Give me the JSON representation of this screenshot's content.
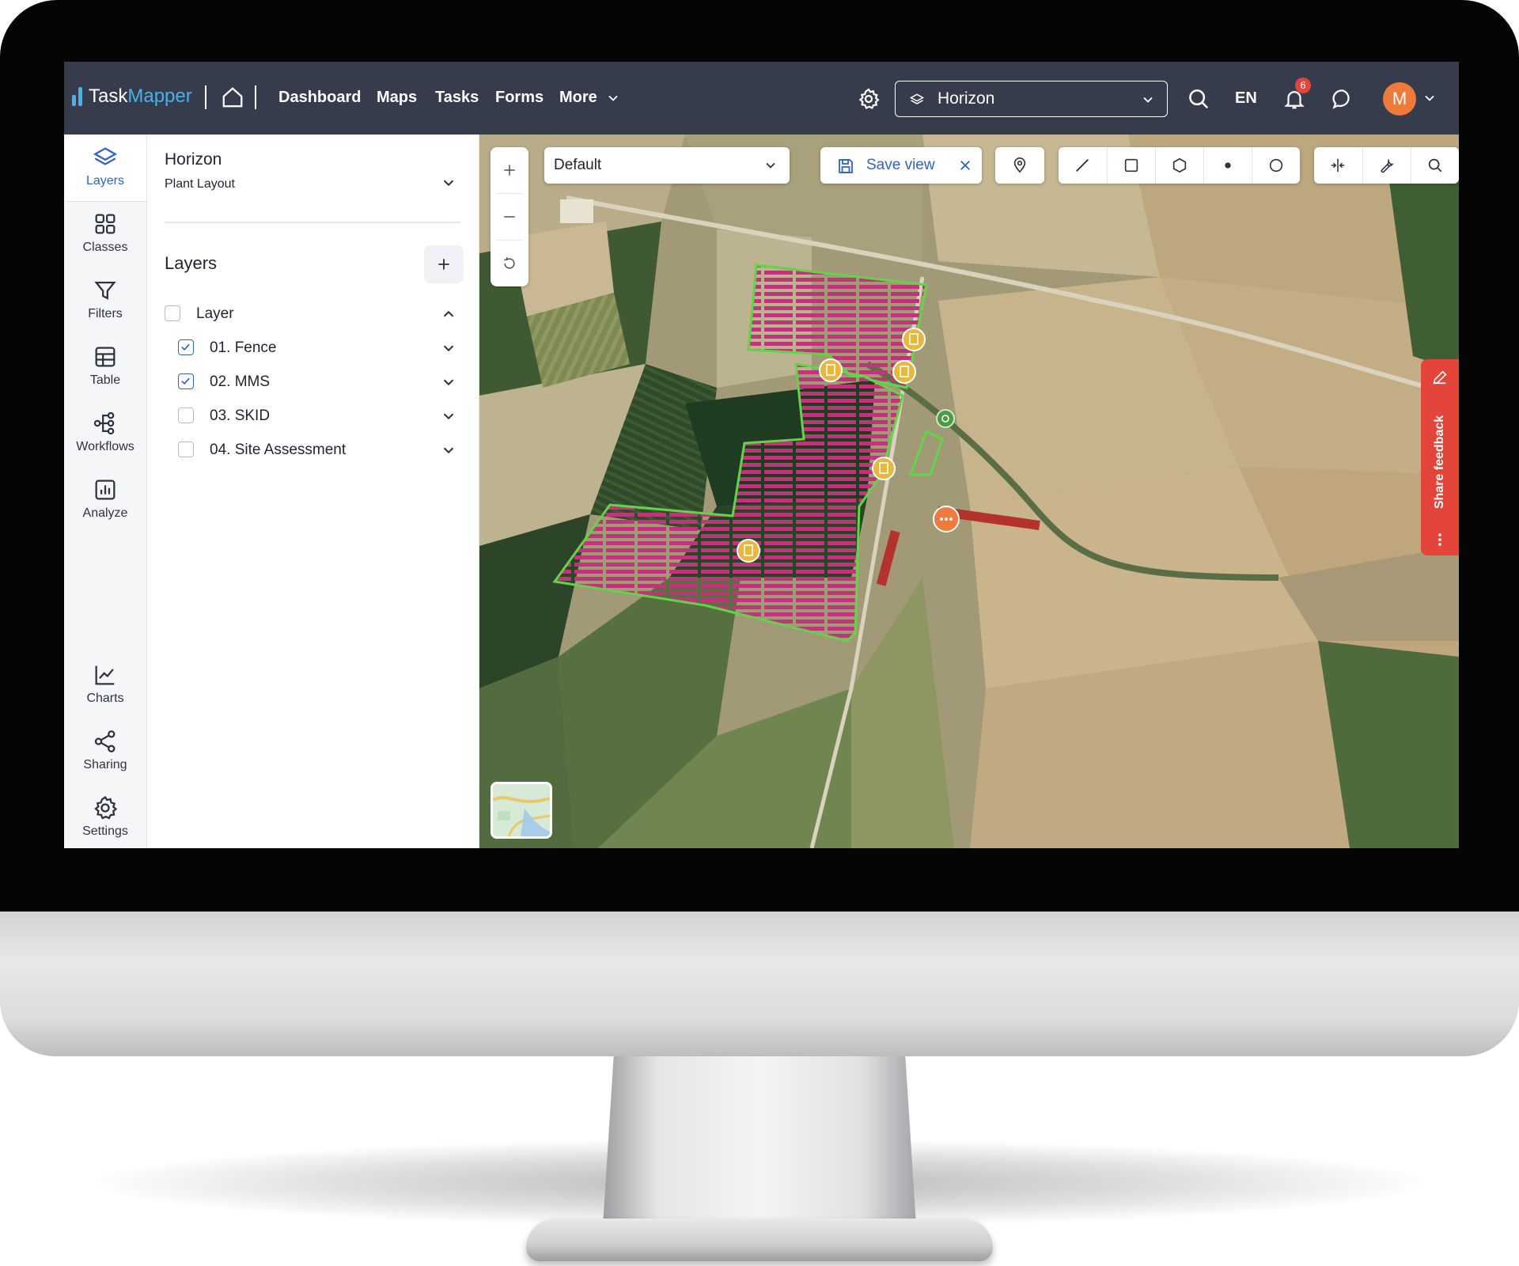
{
  "app": {
    "name_part1": "Task",
    "name_part2": "Mapper"
  },
  "topnav": {
    "items": [
      {
        "label": "Dashboard"
      },
      {
        "label": "Maps"
      },
      {
        "label": "Tasks"
      },
      {
        "label": "Forms"
      },
      {
        "label": "More"
      }
    ],
    "project": "Horizon",
    "language": "EN",
    "notifications": "6",
    "avatar_initial": "M"
  },
  "rail": {
    "items": [
      {
        "label": "Layers",
        "icon": "layers-icon"
      },
      {
        "label": "Classes",
        "icon": "grid-icon"
      },
      {
        "label": "Filters",
        "icon": "filter-icon"
      },
      {
        "label": "Table",
        "icon": "table-icon"
      },
      {
        "label": "Workflows",
        "icon": "workflow-icon"
      },
      {
        "label": "Analyze",
        "icon": "bar-chart-icon"
      },
      {
        "label": "Charts",
        "icon": "line-chart-icon"
      },
      {
        "label": "Sharing",
        "icon": "share-icon"
      },
      {
        "label": "Settings",
        "icon": "gear-icon"
      }
    ]
  },
  "panel": {
    "title": "Horizon",
    "subtitle": "Plant Layout",
    "heading": "Layers",
    "group": {
      "label": "Layer",
      "checked": false,
      "expanded": true
    },
    "layers": [
      {
        "label": "01. Fence",
        "checked": true
      },
      {
        "label": "02. MMS",
        "checked": true
      },
      {
        "label": "03. SKID",
        "checked": false
      },
      {
        "label": "04. Site Assessment",
        "checked": false
      }
    ]
  },
  "map": {
    "view": "Default",
    "save_label": "Save view",
    "feedback_label": "Share feedback",
    "colors": {
      "panel_rows": "#c0347a",
      "boundary": "#63d44a",
      "marker": "#e8b83c",
      "marker_alert": "#ee7b3b"
    }
  },
  "colors": {
    "topbar": "#373c4c",
    "accent": "#2e62c9",
    "brand": "#46b3e6",
    "feedback": "#e4453a",
    "avatar": "#ee7b3b"
  }
}
